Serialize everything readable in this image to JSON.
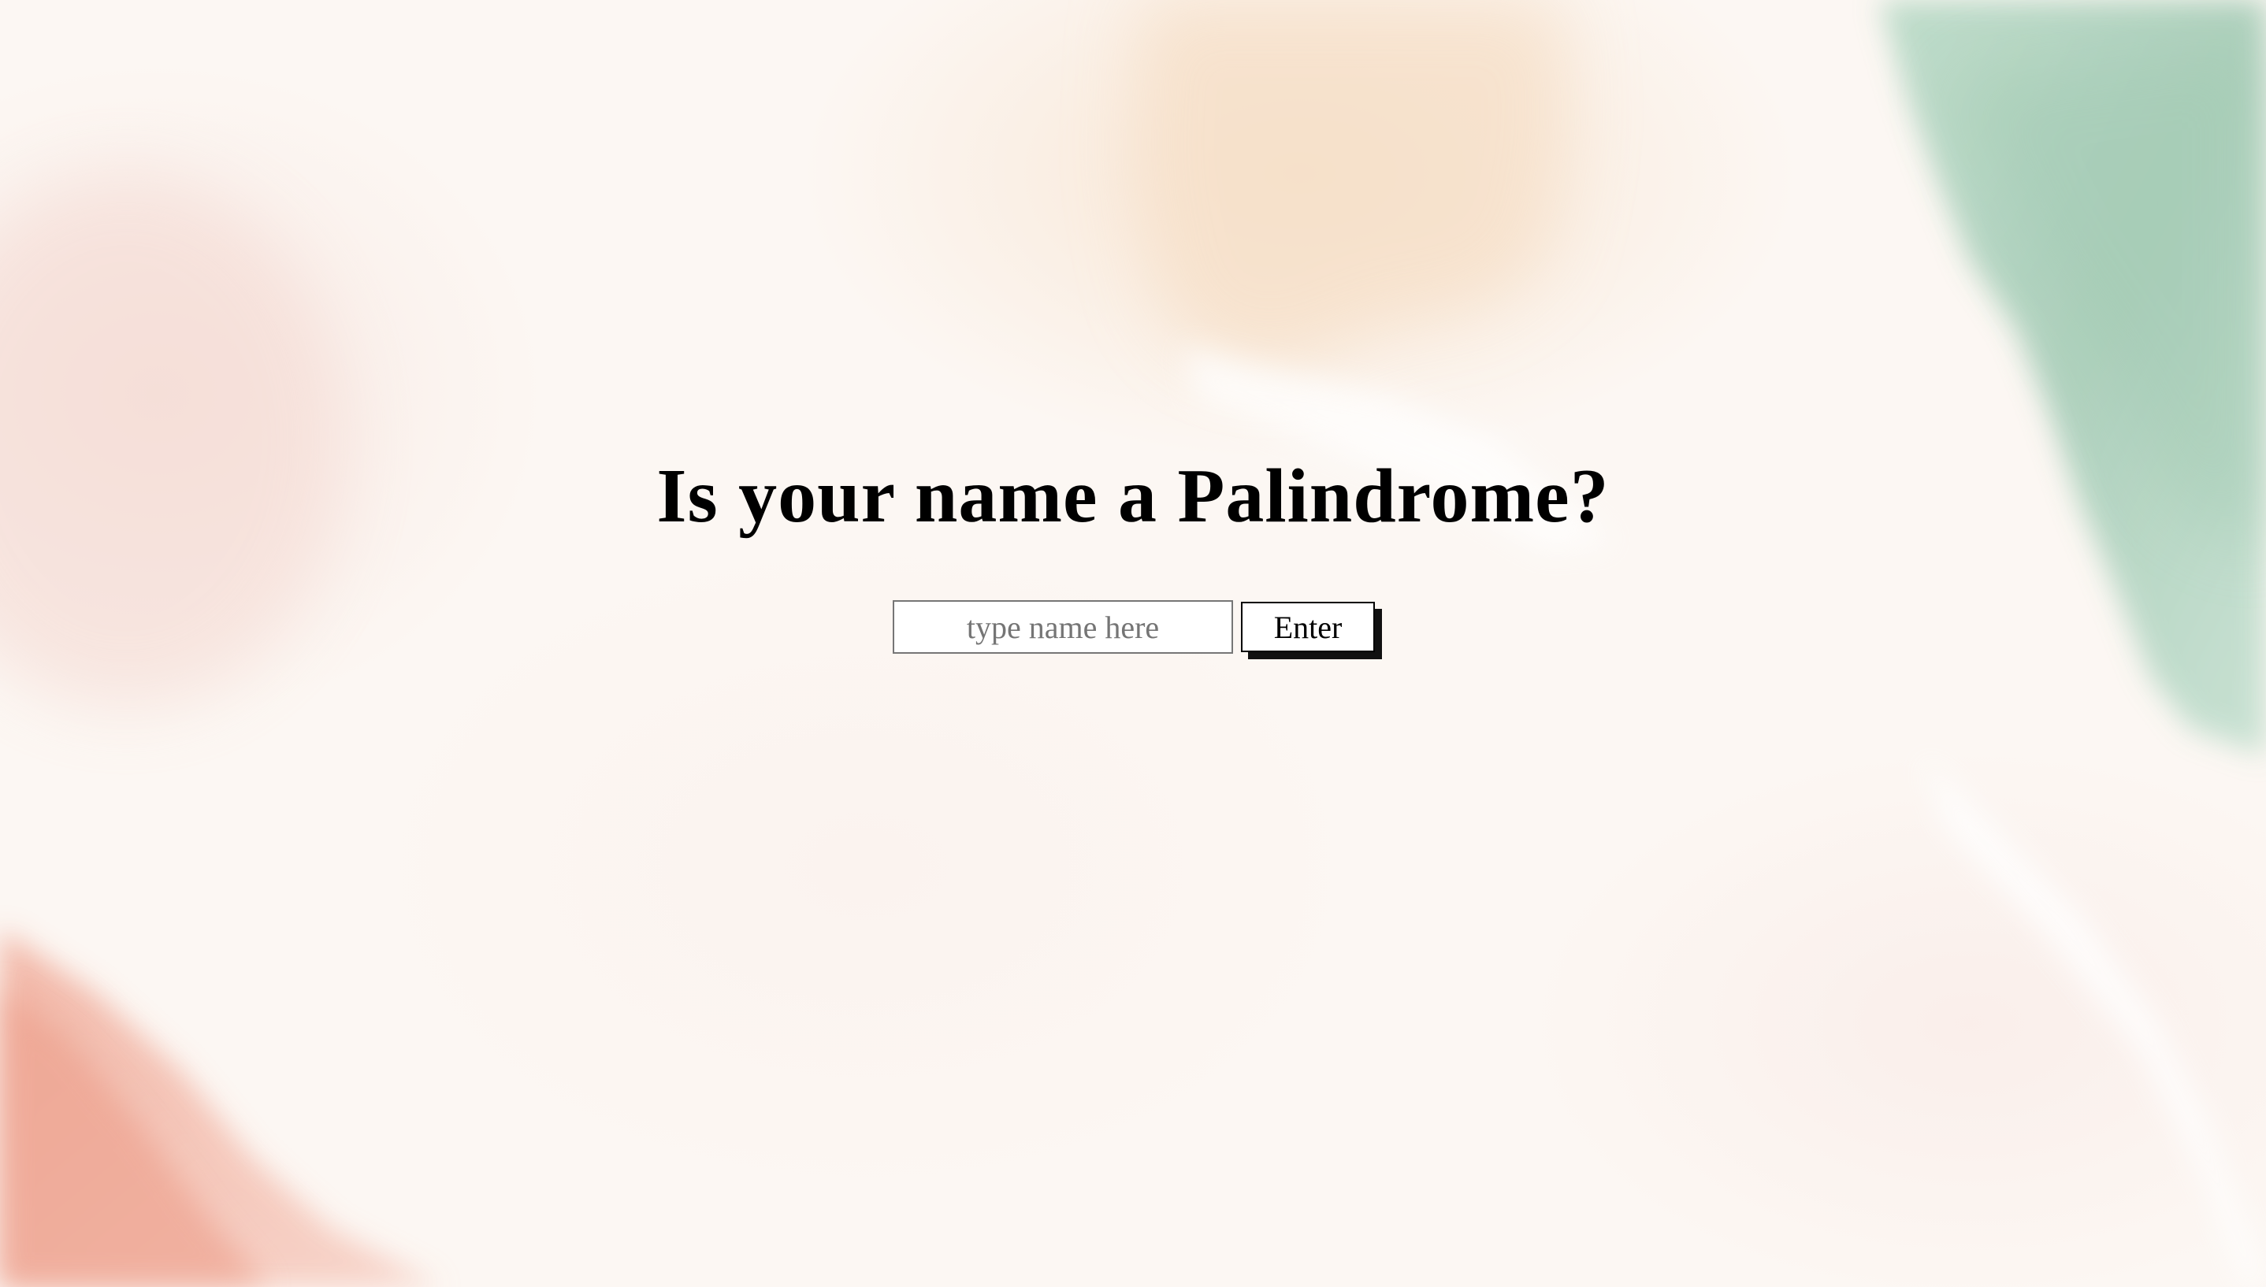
{
  "page": {
    "title": "Is your name a Palindrome?"
  },
  "form": {
    "name_placeholder": "type name here",
    "name_value": "",
    "enter_label": "Enter"
  },
  "colors": {
    "background": "#fcf7f3",
    "green_wash": "#a9cfba",
    "peach_wash": "#f6ddc4",
    "coral_wash": "#ec9a85",
    "text": "#000000"
  }
}
